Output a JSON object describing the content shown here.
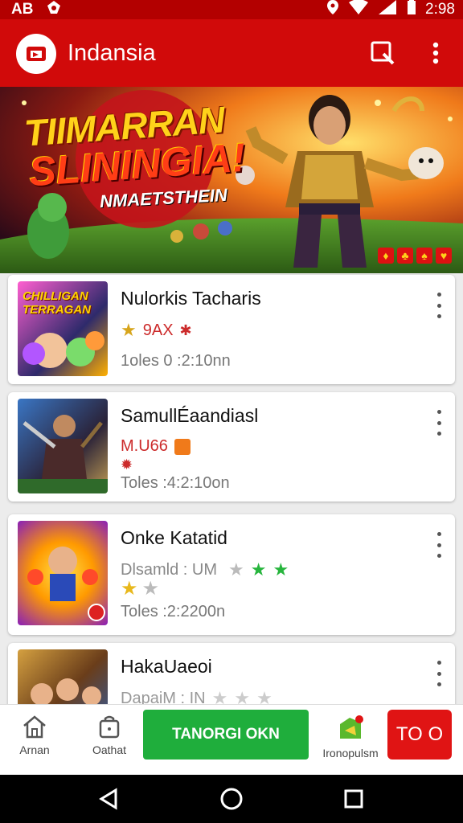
{
  "status_bar": {
    "left_text": "AB",
    "time": "2:98"
  },
  "app_bar": {
    "title": "Indansia"
  },
  "banner": {
    "title_line1": "TIIMARRAN",
    "title_line2": "SLININGIA!",
    "subtitle": "NMAETSTHEIN",
    "badges": [
      "♦",
      "♣",
      "♠",
      "♥"
    ]
  },
  "items": [
    {
      "title": "Nulorkis Tacharis",
      "rating": "9AX",
      "extra": "",
      "time": "1oles 0 :2:10nn",
      "thumb_text": "CHILLIGAN TERRAGAN",
      "thumb_colors": [
        "#ff5fd0",
        "#2e2a6b",
        "#ffb000"
      ],
      "stars": []
    },
    {
      "title": "SamullÉaandiasl",
      "rating": "M.U66",
      "extra": "✹",
      "time": "Toles :4:2:10on",
      "thumb_text": "",
      "thumb_colors": [
        "#3a76c4",
        "#2a2238",
        "#c4a055"
      ],
      "stars": []
    },
    {
      "title": "Onke Katatid",
      "rating": "Dlsamld : UM",
      "extra": "",
      "time": "Toles :2:2200n",
      "thumb_text": "",
      "thumb_colors": [
        "#ff9a00",
        "#8a1fb8",
        "#ffe04a"
      ],
      "stars": [
        "grey",
        "green",
        "green"
      ],
      "stars2": [
        "gold",
        "grey"
      ]
    },
    {
      "title": "HakaUaeoi",
      "rating": "DapaiM : IN",
      "extra": "",
      "time": "",
      "thumb_text": "",
      "thumb_colors": [
        "#6a3d1a",
        "#2b60b0",
        "#d4a040"
      ],
      "stars": [
        "grey",
        "grey",
        "grey"
      ]
    }
  ],
  "bottom_nav": {
    "home_label": "Arnan",
    "cart_label": "Oathat",
    "cta_label": "TANORGI OKN",
    "promo_label": "Ironopulsm",
    "red_label": "TO O"
  },
  "colors": {
    "primary": "#d10a0a",
    "cta": "#1fae3c",
    "star_gold": "#d7a51c",
    "star_green": "#27b53d"
  }
}
